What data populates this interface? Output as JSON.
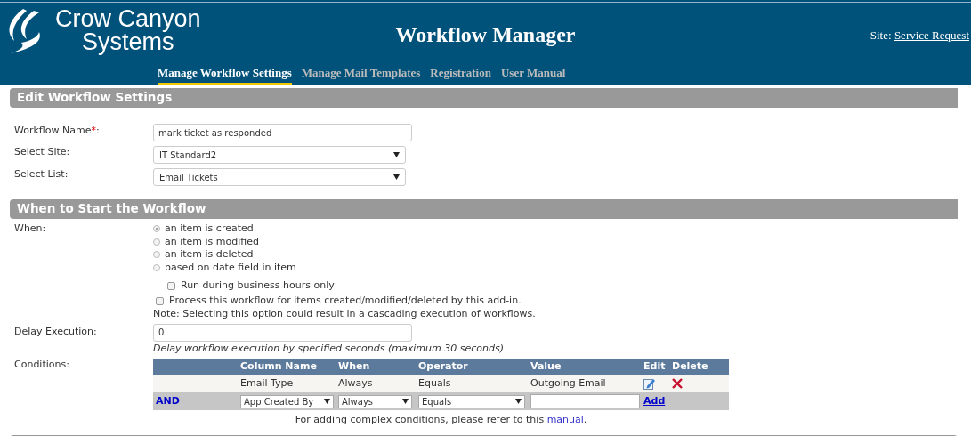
{
  "header": {
    "logo_line1": "Crow Canyon",
    "logo_line2": "Systems",
    "title": "Workflow Manager",
    "site_label": "Site:",
    "site_link": "Service Request",
    "nav": [
      {
        "label": "Manage Workflow Settings",
        "selected": true
      },
      {
        "label": "Manage Mail Templates",
        "selected": false
      },
      {
        "label": "Registration",
        "selected": false
      },
      {
        "label": "User Manual",
        "selected": false
      }
    ]
  },
  "settings": {
    "title": "Edit Workflow Settings",
    "name_label": "Workflow Name",
    "required_mark": "*",
    "name_colon": ":",
    "name_value": "mark ticket as responded",
    "site_label": "Select Site:",
    "site_value": "IT Standard2",
    "list_label": "Select List:",
    "list_value": "Email Tickets"
  },
  "start": {
    "title": "When to Start the Workflow",
    "when_label": "When:",
    "options": [
      {
        "label": "an item is created",
        "selected": true
      },
      {
        "label": "an item is modified",
        "selected": false
      },
      {
        "label": "an item is deleted",
        "selected": false
      },
      {
        "label": "based on date field in item",
        "selected": false
      }
    ],
    "business_hours": {
      "label": "Run during business hours only",
      "checked": false
    },
    "process_addin": {
      "label": "Process this workflow for items created/modified/deleted by this add-in.",
      "checked": false
    },
    "note": "Note: Selecting this option could result in a cascading execution of workflows.",
    "delay_label": "Delay Execution:",
    "delay_value": "0",
    "delay_help": "Delay workflow execution by specified seconds (maximum 30 seconds)",
    "conditions_label": "Conditions:",
    "conditions": {
      "columns": [
        "Column Name",
        "When",
        "Operator",
        "Value",
        "Edit",
        "Delete"
      ],
      "rows": [
        {
          "column_name": "Email Type",
          "when": "Always",
          "operator": "Equals",
          "value": "Outgoing Email"
        }
      ],
      "new_row": {
        "joiner": "AND",
        "column_name": "App Created By",
        "when": "Always",
        "operator": "Equals",
        "add": "Add"
      }
    },
    "footnote": "For adding complex conditions, please refer to this",
    "footnote_link": "manual",
    "footnote_end": "."
  }
}
